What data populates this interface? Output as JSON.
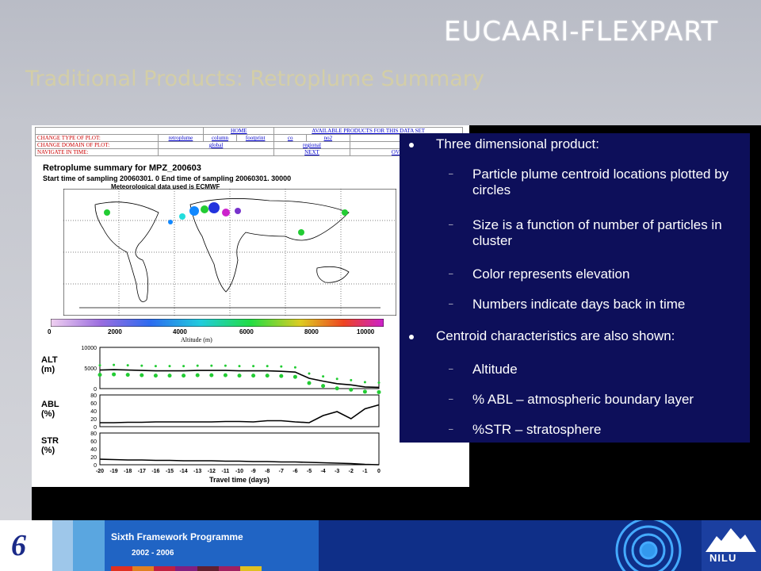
{
  "slide": {
    "title": "EUCAARI-FLEXPART",
    "subtitle": "Traditional Products: Retroplume Summary"
  },
  "figure": {
    "nav": {
      "home": "HOME",
      "available": "AVAILABLE PRODUCTS FOR THIS DATA SET",
      "change_type": "CHANGE TYPE OF PLOT:",
      "types": [
        "retroplume",
        "column",
        "footprint",
        "co",
        "no2"
      ],
      "change_domain": "CHANGE DOMAIN OF PLOT:",
      "domains": [
        "global",
        "regional",
        "local"
      ],
      "navigate": "NAVIGATE IN TIME:",
      "next": "NEXT",
      "overview": "OVERVIEW"
    },
    "plot_title": "Retroplume summary for MPZ_200603",
    "sampling_line": "Start time of sampling 20060301.    0   End time of sampling 20060301. 30000",
    "met_line": "Meteorological data used is ECMWF",
    "colorbar_ticks": [
      "0",
      "2000",
      "4000",
      "6000",
      "8000",
      "10000"
    ],
    "colorbar_title": "Altitude (m)",
    "alt_label": [
      "ALT",
      "(m)"
    ],
    "abl_label": [
      "ABL",
      "(%)"
    ],
    "str_label": [
      "STR",
      "(%)"
    ],
    "alt_ticks": [
      "10000",
      "5000",
      "0"
    ],
    "pct_ticks": [
      "80",
      "60",
      "40",
      "20",
      "0"
    ],
    "x_ticks": [
      "-20",
      "-19",
      "-18",
      "-17",
      "-16",
      "-15",
      "-14",
      "-13",
      "-12",
      "-11",
      "-10",
      "-9",
      "-8",
      "-7",
      "-6",
      "-5",
      "-4",
      "-3",
      "-2",
      "-1",
      "0"
    ],
    "xlabel": "Travel time (days)"
  },
  "chart_data": [
    {
      "type": "line",
      "title": "",
      "xlabel": "Travel time (days)",
      "ylabel": "ALT (m)",
      "x": [
        -20,
        -19,
        -18,
        -17,
        -16,
        -15,
        -14,
        -13,
        -12,
        -11,
        -10,
        -9,
        -8,
        -7,
        -6,
        -5,
        -4,
        -3,
        -2,
        -1,
        0
      ],
      "series": [
        {
          "values": [
            4500,
            4600,
            4500,
            4400,
            4300,
            4300,
            4300,
            4400,
            4400,
            4400,
            4300,
            4300,
            4300,
            4200,
            4000,
            2500,
            1800,
            1200,
            900,
            400,
            300
          ]
        }
      ],
      "ylim": [
        0,
        10000
      ]
    },
    {
      "type": "line",
      "title": "",
      "xlabel": "Travel time (days)",
      "ylabel": "ABL (%)",
      "x": [
        -20,
        -19,
        -18,
        -17,
        -16,
        -15,
        -14,
        -13,
        -12,
        -11,
        -10,
        -9,
        -8,
        -7,
        -6,
        -5,
        -4,
        -3,
        -2,
        -1,
        0
      ],
      "series": [
        {
          "values": [
            10,
            10,
            11,
            11,
            12,
            12,
            12,
            12,
            12,
            13,
            13,
            12,
            15,
            15,
            12,
            10,
            28,
            38,
            20,
            45,
            55
          ]
        }
      ],
      "ylim": [
        0,
        80
      ]
    },
    {
      "type": "line",
      "title": "",
      "xlabel": "Travel time (days)",
      "ylabel": "STR (%)",
      "x": [
        -20,
        -19,
        -18,
        -17,
        -16,
        -15,
        -14,
        -13,
        -12,
        -11,
        -10,
        -9,
        -8,
        -7,
        -6,
        -5,
        -4,
        -3,
        -2,
        -1,
        0
      ],
      "series": [
        {
          "values": [
            14,
            13,
            12,
            12,
            11,
            11,
            10,
            10,
            10,
            9,
            9,
            8,
            8,
            7,
            7,
            6,
            5,
            4,
            3,
            1,
            0
          ]
        }
      ],
      "ylim": [
        0,
        80
      ]
    }
  ],
  "bullets": [
    {
      "level": 1,
      "text": "Three dimensional product:"
    },
    {
      "level": 2,
      "text": "Particle plume centroid locations plotted by circles"
    },
    {
      "level": 2,
      "text": "Size is a function of number of particles in cluster"
    },
    {
      "level": 2,
      "text": "Color represents elevation"
    },
    {
      "level": 2,
      "text": "Numbers indicate days back in time"
    },
    {
      "level": 1,
      "text": "Centroid characteristics are also shown:"
    },
    {
      "level": 2,
      "text": "Altitude"
    },
    {
      "level": 2,
      "text": "% ABL – atmospheric boundary layer"
    },
    {
      "level": 2,
      "text": "%STR – stratosphere"
    }
  ],
  "footer": {
    "programme": "Sixth Framework Programme",
    "years": "2002 - 2006",
    "logo_mark": "6",
    "org": "NILU"
  },
  "colors": {
    "bullet_bg": "#0d0f5a",
    "footer_bg": "#0f2f88",
    "subtitle": "#e4d88a",
    "plume": "#22cc33"
  }
}
